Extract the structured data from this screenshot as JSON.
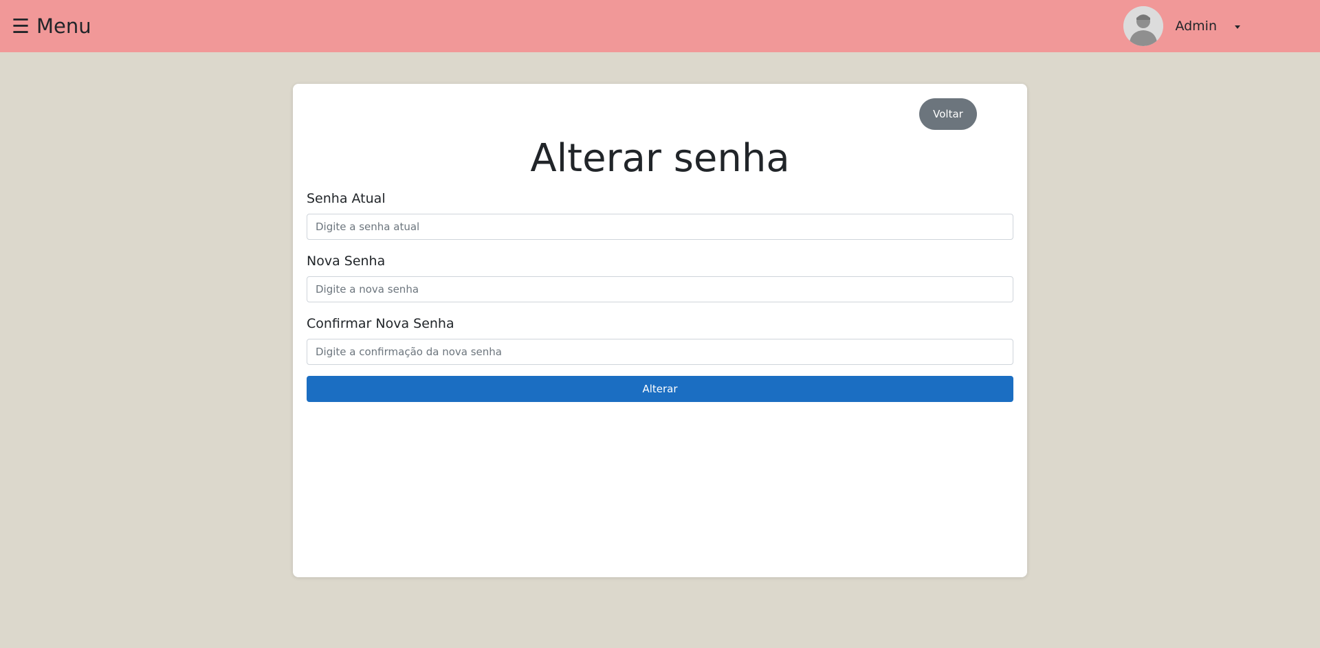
{
  "navbar": {
    "menu_icon": "☰",
    "menu_icon_name": "hamburger-menu-icon",
    "menu_label": "Menu",
    "user_name": "Admin",
    "avatar_icon": "user-avatar-icon",
    "dropdown_icon": "caret-down-icon",
    "background_color": "#f19898"
  },
  "form": {
    "back_label": "Voltar",
    "title": "Alterar senha",
    "fields": [
      {
        "label": "Senha Atual",
        "placeholder": "Digite a senha atual"
      },
      {
        "label": "Nova Senha",
        "placeholder": "Digite a nova senha"
      },
      {
        "label": "Confirmar Nova Senha",
        "placeholder": "Digite a confirmação da nova senha"
      }
    ],
    "submit_label": "Alterar",
    "submit_color": "#1b6ec2",
    "back_color": "#6c757d"
  },
  "page": {
    "background_color": "#dcd8cc"
  }
}
